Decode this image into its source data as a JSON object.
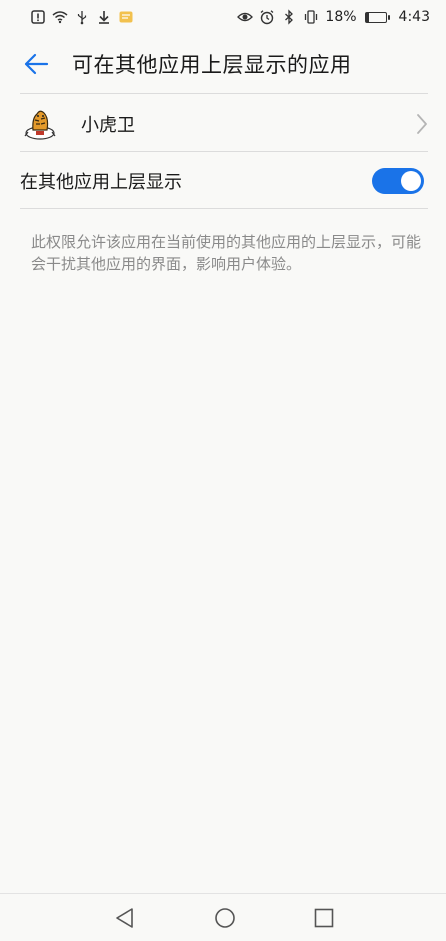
{
  "status_bar": {
    "battery_percent": "18%",
    "battery_level": 0.18,
    "time": "4:43",
    "left_icons": [
      "alert-icon",
      "wifi-icon",
      "usb-icon",
      "download-icon",
      "notification-icon"
    ],
    "right_icons": [
      "eye-icon",
      "alarm-icon",
      "bluetooth-icon",
      "vibrate-icon",
      "battery-icon"
    ]
  },
  "header": {
    "title": "可在其他应用上层显示的应用",
    "back_icon": "arrow-left-icon"
  },
  "app_row": {
    "name": "小虎卫",
    "icon": "tiger-app-icon",
    "chevron": "chevron-right-icon"
  },
  "permission": {
    "label": "在其他应用上层显示",
    "enabled": true,
    "description": "此权限允许该应用在当前使用的其他应用的上层显示，可能会干扰其他应用的界面，影响用户体验。"
  },
  "nav_bar": {
    "back": "triangle-back-icon",
    "home": "circle-home-icon",
    "recents": "square-recents-icon"
  },
  "colors": {
    "accent": "#1a73e8",
    "background": "#f9f9f7",
    "text_secondary": "#8a8a8a"
  }
}
